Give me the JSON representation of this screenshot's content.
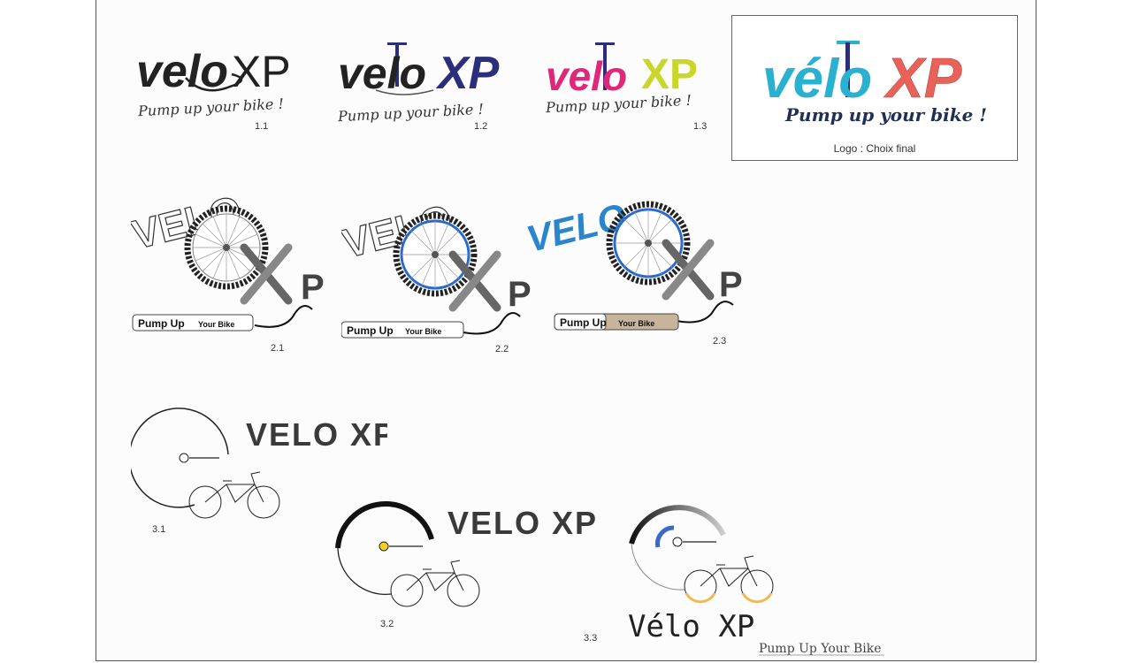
{
  "sheet": {
    "tagline": "Pump up your bike !",
    "final_caption": "Logo : Choix final",
    "row1": [
      {
        "part1": "velo",
        "part2": "XP",
        "number": "1.1"
      },
      {
        "part1": "velo",
        "part2": "XP",
        "number": "1.2"
      },
      {
        "part1": "velo",
        "part2": "XP",
        "number": "1.3"
      },
      {
        "part1": "vélo",
        "part2": "XP"
      }
    ],
    "row2": [
      {
        "word": "VELO",
        "letter": "P",
        "pump_left": "Pump Up",
        "pump_right": "Your Bike",
        "number": "2.1"
      },
      {
        "word": "VELO",
        "letter": "P",
        "pump_left": "Pump Up",
        "pump_right": "Your Bike",
        "number": "2.2"
      },
      {
        "word": "VELO",
        "letter": "P",
        "pump_left": "Pump Up",
        "pump_right": "Your Bike",
        "number": "2.3"
      }
    ],
    "row3": [
      {
        "title": "VELO XP",
        "number": "3.1"
      },
      {
        "title": "VELO XP",
        "number": "3.2"
      },
      {
        "title": "Vélo XP",
        "subtitle": "Pump Up Your Bike",
        "number": "3.3"
      }
    ]
  },
  "colors": {
    "dark": "#222222",
    "navy": "#2b2f7a",
    "magenta": "#e0287a",
    "lime": "#c9d62a",
    "cyan": "#2ab0d0",
    "coral": "#e8625a",
    "blue": "#2a86cc",
    "tan": "#c8b49a",
    "yellow": "#f2d21a"
  },
  "icons": [
    "floor-pump-icon",
    "bike-wheel-icon",
    "wrench-icon",
    "bicycle-icon"
  ]
}
